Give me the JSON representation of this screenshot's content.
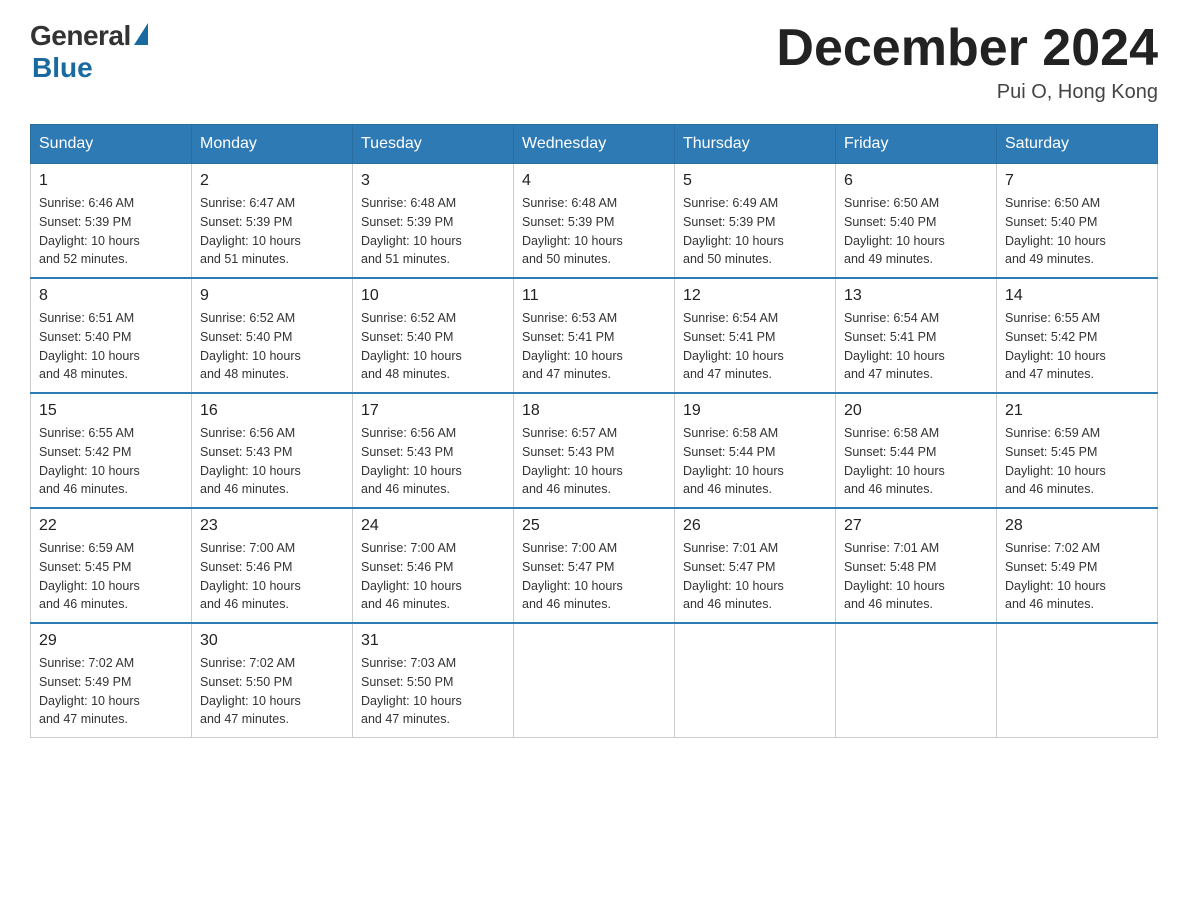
{
  "logo": {
    "general": "General",
    "blue": "Blue"
  },
  "title": {
    "month_year": "December 2024",
    "location": "Pui O, Hong Kong"
  },
  "days_of_week": [
    "Sunday",
    "Monday",
    "Tuesday",
    "Wednesday",
    "Thursday",
    "Friday",
    "Saturday"
  ],
  "weeks": [
    [
      {
        "day": "1",
        "sunrise": "6:46 AM",
        "sunset": "5:39 PM",
        "daylight": "10 hours and 52 minutes."
      },
      {
        "day": "2",
        "sunrise": "6:47 AM",
        "sunset": "5:39 PM",
        "daylight": "10 hours and 51 minutes."
      },
      {
        "day": "3",
        "sunrise": "6:48 AM",
        "sunset": "5:39 PM",
        "daylight": "10 hours and 51 minutes."
      },
      {
        "day": "4",
        "sunrise": "6:48 AM",
        "sunset": "5:39 PM",
        "daylight": "10 hours and 50 minutes."
      },
      {
        "day": "5",
        "sunrise": "6:49 AM",
        "sunset": "5:39 PM",
        "daylight": "10 hours and 50 minutes."
      },
      {
        "day": "6",
        "sunrise": "6:50 AM",
        "sunset": "5:40 PM",
        "daylight": "10 hours and 49 minutes."
      },
      {
        "day": "7",
        "sunrise": "6:50 AM",
        "sunset": "5:40 PM",
        "daylight": "10 hours and 49 minutes."
      }
    ],
    [
      {
        "day": "8",
        "sunrise": "6:51 AM",
        "sunset": "5:40 PM",
        "daylight": "10 hours and 48 minutes."
      },
      {
        "day": "9",
        "sunrise": "6:52 AM",
        "sunset": "5:40 PM",
        "daylight": "10 hours and 48 minutes."
      },
      {
        "day": "10",
        "sunrise": "6:52 AM",
        "sunset": "5:40 PM",
        "daylight": "10 hours and 48 minutes."
      },
      {
        "day": "11",
        "sunrise": "6:53 AM",
        "sunset": "5:41 PM",
        "daylight": "10 hours and 47 minutes."
      },
      {
        "day": "12",
        "sunrise": "6:54 AM",
        "sunset": "5:41 PM",
        "daylight": "10 hours and 47 minutes."
      },
      {
        "day": "13",
        "sunrise": "6:54 AM",
        "sunset": "5:41 PM",
        "daylight": "10 hours and 47 minutes."
      },
      {
        "day": "14",
        "sunrise": "6:55 AM",
        "sunset": "5:42 PM",
        "daylight": "10 hours and 47 minutes."
      }
    ],
    [
      {
        "day": "15",
        "sunrise": "6:55 AM",
        "sunset": "5:42 PM",
        "daylight": "10 hours and 46 minutes."
      },
      {
        "day": "16",
        "sunrise": "6:56 AM",
        "sunset": "5:43 PM",
        "daylight": "10 hours and 46 minutes."
      },
      {
        "day": "17",
        "sunrise": "6:56 AM",
        "sunset": "5:43 PM",
        "daylight": "10 hours and 46 minutes."
      },
      {
        "day": "18",
        "sunrise": "6:57 AM",
        "sunset": "5:43 PM",
        "daylight": "10 hours and 46 minutes."
      },
      {
        "day": "19",
        "sunrise": "6:58 AM",
        "sunset": "5:44 PM",
        "daylight": "10 hours and 46 minutes."
      },
      {
        "day": "20",
        "sunrise": "6:58 AM",
        "sunset": "5:44 PM",
        "daylight": "10 hours and 46 minutes."
      },
      {
        "day": "21",
        "sunrise": "6:59 AM",
        "sunset": "5:45 PM",
        "daylight": "10 hours and 46 minutes."
      }
    ],
    [
      {
        "day": "22",
        "sunrise": "6:59 AM",
        "sunset": "5:45 PM",
        "daylight": "10 hours and 46 minutes."
      },
      {
        "day": "23",
        "sunrise": "7:00 AM",
        "sunset": "5:46 PM",
        "daylight": "10 hours and 46 minutes."
      },
      {
        "day": "24",
        "sunrise": "7:00 AM",
        "sunset": "5:46 PM",
        "daylight": "10 hours and 46 minutes."
      },
      {
        "day": "25",
        "sunrise": "7:00 AM",
        "sunset": "5:47 PM",
        "daylight": "10 hours and 46 minutes."
      },
      {
        "day": "26",
        "sunrise": "7:01 AM",
        "sunset": "5:47 PM",
        "daylight": "10 hours and 46 minutes."
      },
      {
        "day": "27",
        "sunrise": "7:01 AM",
        "sunset": "5:48 PM",
        "daylight": "10 hours and 46 minutes."
      },
      {
        "day": "28",
        "sunrise": "7:02 AM",
        "sunset": "5:49 PM",
        "daylight": "10 hours and 46 minutes."
      }
    ],
    [
      {
        "day": "29",
        "sunrise": "7:02 AM",
        "sunset": "5:49 PM",
        "daylight": "10 hours and 47 minutes."
      },
      {
        "day": "30",
        "sunrise": "7:02 AM",
        "sunset": "5:50 PM",
        "daylight": "10 hours and 47 minutes."
      },
      {
        "day": "31",
        "sunrise": "7:03 AM",
        "sunset": "5:50 PM",
        "daylight": "10 hours and 47 minutes."
      },
      null,
      null,
      null,
      null
    ]
  ]
}
